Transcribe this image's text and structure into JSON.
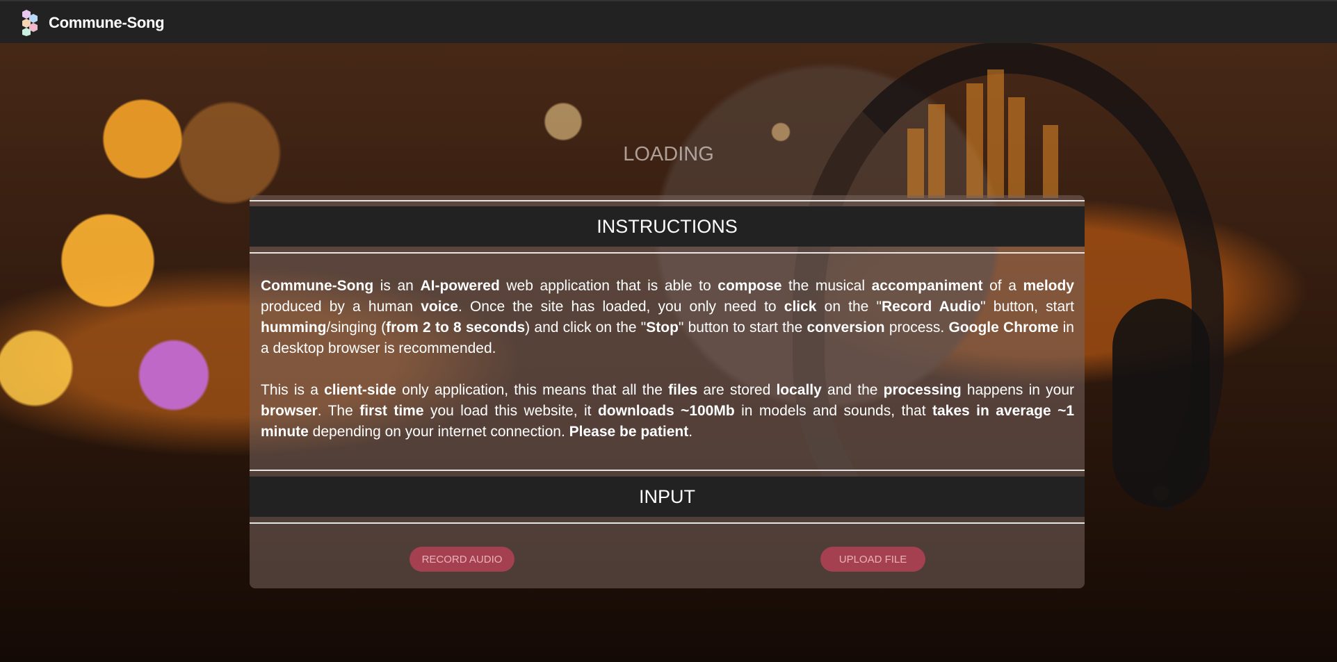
{
  "app": {
    "brand": "Commune-Song"
  },
  "status": {
    "loading_text": "LOADING"
  },
  "instructions": {
    "heading": "INSTRUCTIONS",
    "p1": [
      {
        "t": "Commune-Song",
        "b": true
      },
      {
        "t": " is an "
      },
      {
        "t": "AI-powered",
        "b": true
      },
      {
        "t": " web application that is able to "
      },
      {
        "t": "compose",
        "b": true
      },
      {
        "t": " the musical "
      },
      {
        "t": "accompaniment",
        "b": true
      },
      {
        "t": " of a "
      },
      {
        "t": "melody",
        "b": true
      },
      {
        "t": " produced by a human "
      },
      {
        "t": "voice",
        "b": true
      },
      {
        "t": ". Once the site has loaded, you only need to "
      },
      {
        "t": "click",
        "b": true
      },
      {
        "t": " on the \""
      },
      {
        "t": "Record Audio",
        "b": true
      },
      {
        "t": "\" button, start "
      },
      {
        "t": "humming",
        "b": true
      },
      {
        "t": "/singing ("
      },
      {
        "t": "from 2 to 8 seconds",
        "b": true
      },
      {
        "t": ") and click on the \""
      },
      {
        "t": "Stop",
        "b": true
      },
      {
        "t": "\" button to start the "
      },
      {
        "t": "conversion",
        "b": true
      },
      {
        "t": " process. "
      },
      {
        "t": "Google Chrome",
        "b": true
      },
      {
        "t": " in a desktop browser is recommended."
      }
    ],
    "p2": [
      {
        "t": "This is a "
      },
      {
        "t": "client-side",
        "b": true
      },
      {
        "t": " only application, this means that all the "
      },
      {
        "t": "files",
        "b": true
      },
      {
        "t": " are stored "
      },
      {
        "t": "locally",
        "b": true
      },
      {
        "t": " and the "
      },
      {
        "t": "processing",
        "b": true
      },
      {
        "t": " happens in your "
      },
      {
        "t": "browser",
        "b": true
      },
      {
        "t": ". The "
      },
      {
        "t": "first time",
        "b": true
      },
      {
        "t": " you load this website, it "
      },
      {
        "t": "downloads ~100Mb",
        "b": true
      },
      {
        "t": " in models and sounds, that "
      },
      {
        "t": "takes in average ~1 minute",
        "b": true
      },
      {
        "t": " depending on your internet connection. "
      },
      {
        "t": "Please be patient",
        "b": true
      },
      {
        "t": "."
      }
    ]
  },
  "input": {
    "heading": "INPUT",
    "record_label": "RECORD AUDIO",
    "upload_label": "UPLOAD FILE"
  },
  "colors": {
    "topbar": "#222222",
    "button": "#a4404f",
    "section_head": "#222222"
  }
}
